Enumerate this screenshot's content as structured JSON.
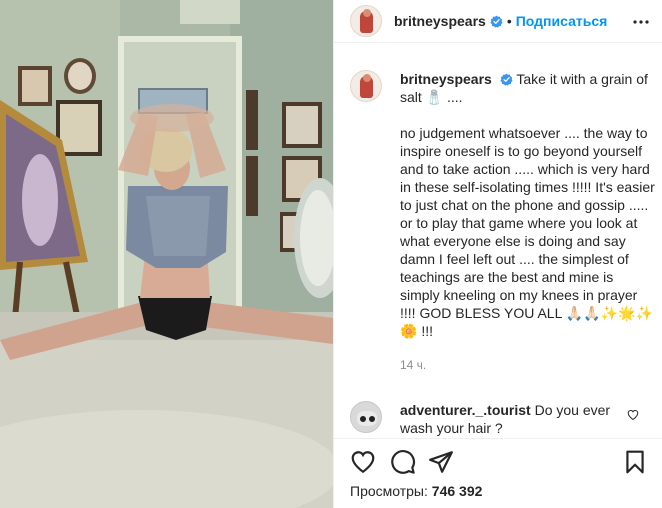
{
  "post": {
    "username": "britneyspears",
    "dot": "•",
    "follow_label": "Подписаться"
  },
  "caption": {
    "username": "britneyspears",
    "first_line": "Take it with a grain of salt 🧂 ....",
    "body": "no judgement whatsoever .... the way to inspire oneself is to go beyond yourself and to take action ..... which is very hard in these self-isolating times !!!!! It's easier to just chat on the phone and gossip ..... or to play that game where you look at what everyone else is doing and say damn I feel left out .... the simplest of teachings are the best and mine is simply kneeling on my knees in prayer !!!! GOD BLESS YOU ALL 🙏🏻🙏🏻✨🌟✨🌼 !!!",
    "timestamp": "14 ч."
  },
  "comment": {
    "username": "adventurer._.tourist",
    "text": "Do you ever wash your hair ?"
  },
  "actions": {
    "views_label": "Просмотры:",
    "views_count": "746 392"
  },
  "icons": {
    "verified": "verified-badge-icon",
    "more": "more-options-icon",
    "like": "heart-icon",
    "comment": "comment-icon",
    "share": "share-icon",
    "save": "bookmark-icon"
  },
  "colors": {
    "accent": "#0095f6",
    "text": "#262626",
    "muted": "#8e8e8e",
    "border": "#efefef"
  }
}
